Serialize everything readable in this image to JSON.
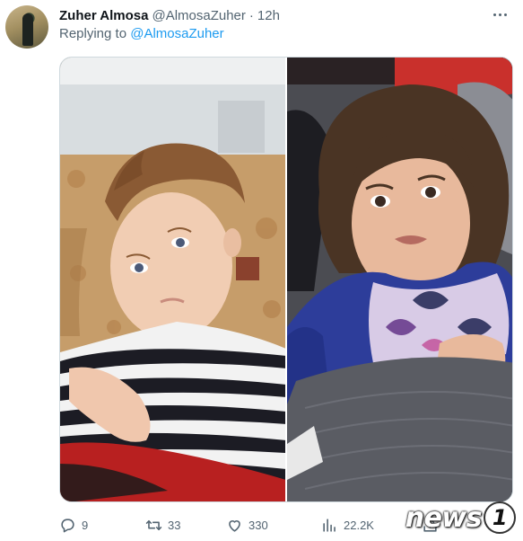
{
  "tweet": {
    "author_name": "Zuher Almosa",
    "author_handle": "@AlmosaZuher",
    "separator": "·",
    "time": "12h",
    "replying_prefix": "Replying to",
    "replying_handle": "@AlmosaZuher"
  },
  "actions": {
    "replies": "9",
    "retweets": "33",
    "likes": "330",
    "views": "22.2K"
  },
  "icons": {
    "more": "more-horizontal-icon",
    "reply": "reply-icon",
    "retweet": "retweet-icon",
    "like": "heart-icon",
    "views": "views-icon",
    "share": "share-icon"
  },
  "watermark": {
    "text": "news",
    "badge": "1"
  },
  "colors": {
    "link": "#1d9bf0",
    "secondary_text": "#536471",
    "primary_text": "#0f1419"
  }
}
